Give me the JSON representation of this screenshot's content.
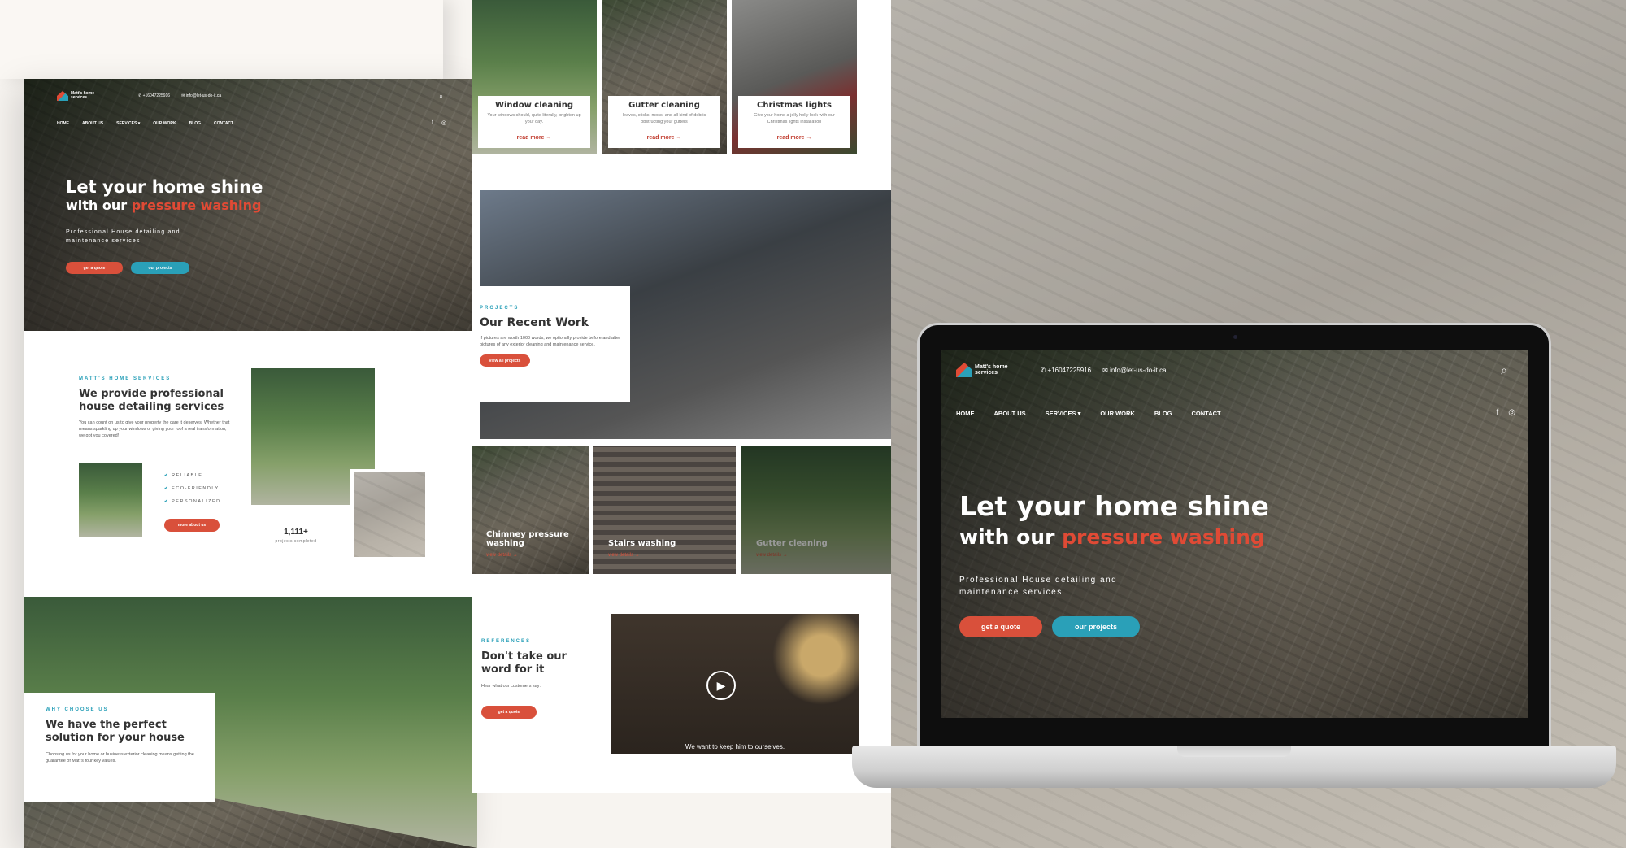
{
  "brand": {
    "name_line1": "Matt's home",
    "name_line2": "services",
    "phone": "+16047225916",
    "email": "info@let-us-do-it.ca",
    "accent": "#e04a35",
    "teal": "#2aa0b8"
  },
  "nav": {
    "items": [
      "HOME",
      "ABOUT US",
      "SERVICES",
      "OUR WORK",
      "BLOG",
      "CONTACT"
    ],
    "services_caret": "▾"
  },
  "icons": {
    "phone": "✆",
    "email": "✉",
    "search": "⌕",
    "facebook": "f",
    "instagram": "◎",
    "arrow": "→",
    "check": "✔",
    "play": "▶"
  },
  "hero": {
    "line1": "Let your home shine",
    "line2_plain": "with our ",
    "line2_accent": "pressure washing",
    "subtitle": "Professional House detailing and maintenance services",
    "btn_quote": "get a quote",
    "btn_projects": "our projects"
  },
  "about": {
    "eyebrow": "MATT'S HOME SERVICES",
    "title": "We provide professional house detailing services",
    "body": "You can count on us to give your property the care it deserves. Whether that means sparkling up your windows or giving your roof a real transformation, we got you covered!",
    "checks": [
      "RELIABLE",
      "ECO-FRIENDLY",
      "PERSONALIZED"
    ],
    "btn": "more about us",
    "stat_value": "1,111+",
    "stat_label": "projects completed"
  },
  "why": {
    "eyebrow": "WHY CHOOSE US",
    "title": "We have the perfect solution for your house",
    "body": "Choosing us for your home or business exterior cleaning means getting the guarantee of Matt's four key values."
  },
  "services": [
    {
      "title": "Window cleaning",
      "desc": "Your windows should, quite literally, brighten up your day.",
      "link": "read more"
    },
    {
      "title": "Gutter cleaning",
      "desc": "leaves, sticks, moss, and all kind of debris obstructing your gutters",
      "link": "read more"
    },
    {
      "title": "Christmas lights",
      "desc": "Give your home a jolly holly look with our Christmas lights installation",
      "link": "read more"
    }
  ],
  "projects": {
    "eyebrow": "PROJECTS",
    "title": "Our Recent Work",
    "body": "If pictures are worth 1000 words, we optionally provide before and after pictures of any exterior cleaning and maintenance service.",
    "btn": "view all projects"
  },
  "work": [
    {
      "title": "Chimney pressure washing",
      "link": "view details"
    },
    {
      "title": "Stairs washing",
      "link": "view details"
    },
    {
      "title": "Gutter cleaning",
      "link": "view details"
    }
  ],
  "references": {
    "eyebrow": "REFERENCES",
    "title": "Don't take our word for it",
    "body": "Hear what our customers say:",
    "btn": "get a quote",
    "video_caption": "We want to keep him to ourselves."
  }
}
